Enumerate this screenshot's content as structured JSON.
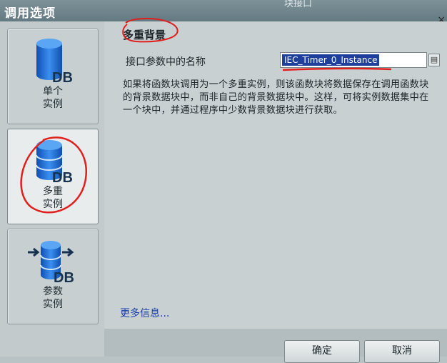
{
  "window": {
    "title": "调用选项",
    "background_tab": "块接口",
    "close_glyph": "×"
  },
  "options": [
    {
      "label_line1": "单个",
      "label_line2": "实例",
      "icon": "single-instance-db-icon",
      "icon_text": "DB"
    },
    {
      "label_line1": "多重",
      "label_line2": "实例",
      "icon": "multi-instance-db-icon",
      "icon_text": "DB",
      "selected": true
    },
    {
      "label_line1": "参数",
      "label_line2": "实例",
      "icon": "parameter-instance-db-icon",
      "icon_text": "DB"
    }
  ],
  "main": {
    "section_title": "多重背景",
    "field_label": "接口参数中的名称",
    "field_value": "IEC_Timer_0_Instance",
    "browse_glyph": "▤",
    "description": "如果将函数块调用为一个多重实例，则该函数块将数据保存在调用函数块的背景数据块中，而非自己的背景数据块中。这样，可将实例数据集中在一个块中，并通过程序中少数背景数据块进行获取。",
    "more_info_link": "更多信息..."
  },
  "buttons": {
    "ok": "确定",
    "cancel": "取消"
  },
  "colors": {
    "db_blue": "#1f6fd0",
    "selection_blue": "#1f3f9c",
    "link_blue": "#1a3ea8",
    "annotation_red": "#e0201c"
  }
}
